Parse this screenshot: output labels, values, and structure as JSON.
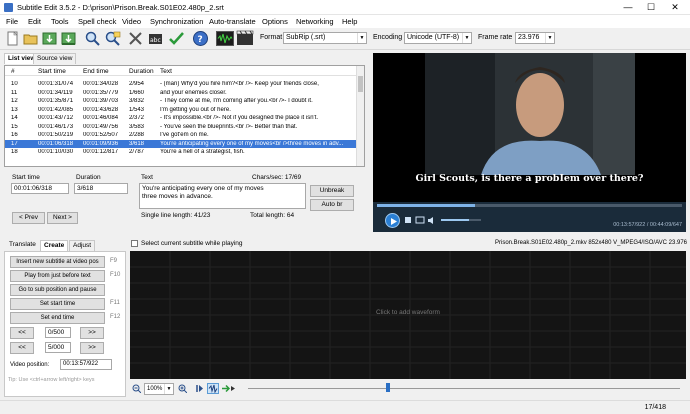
{
  "window": {
    "title": "Subtitle Edit 3.5.2 - D:\\prison\\Prison.Break.S01E02.480p_2.srt",
    "minimize": "—",
    "maximize": "☐",
    "close": "✕"
  },
  "menu": [
    "File",
    "Edit",
    "Tools",
    "Spell check",
    "Video",
    "Synchronization",
    "Auto-translate",
    "Options",
    "Networking",
    "Help"
  ],
  "toolbar": {
    "icons": [
      "new-file-icon",
      "open-folder-icon",
      "save-icon",
      "save-as-icon",
      "find-icon",
      "replace-icon",
      "fix-common-errors-icon",
      "burn-in-icon",
      "spell-check-icon",
      "help-icon",
      "waveform-toggle-icon",
      "video-toggle-icon"
    ],
    "format_label": "Format",
    "format_value": "SubRip (.srt)",
    "encoding_label": "Encoding",
    "encoding_value": "Unicode (UTF-8)",
    "framerate_label": "Frame rate",
    "framerate_value": "23.976"
  },
  "view_tabs": [
    "List view",
    "Source view"
  ],
  "list": {
    "columns": [
      "#",
      "Start time",
      "End time",
      "Duration",
      "Text"
    ],
    "rows": [
      {
        "n": "10",
        "start": "00:01:31/074",
        "end": "00:01:34/028",
        "dur": "2/954",
        "text": "- (man) Why'd you hire him?<br />- Keep your friends close,"
      },
      {
        "n": "11",
        "start": "00:01:34/119",
        "end": "00:01:35/779",
        "dur": "1/660",
        "text": "and your enemies closer."
      },
      {
        "n": "12",
        "start": "00:01:35/871",
        "end": "00:01:39/703",
        "dur": "3/832",
        "text": "- They come at me, I'm coming after you.<br />- I doubt it."
      },
      {
        "n": "13",
        "start": "00:01:42/085",
        "end": "00:01:43/628",
        "dur": "1/543",
        "text": "I'm getting you out of here."
      },
      {
        "n": "14",
        "start": "00:01:43/712",
        "end": "00:01:46/084",
        "dur": "2/372",
        "text": "- It's impossible.<br />- Not if you designed the place it isn't."
      },
      {
        "n": "15",
        "start": "00:01:46/173",
        "end": "00:01:49/756",
        "dur": "3/583",
        "text": "- You've seen the blueprints.<br />- Better than that."
      },
      {
        "n": "16",
        "start": "00:01:50/219",
        "end": "00:01:52/507",
        "dur": "2/288",
        "text": "I've got'em on me."
      },
      {
        "n": "17",
        "start": "00:01:06/318",
        "end": "00:01:09/936",
        "dur": "3/618",
        "text": "You're anticipating every one of my moves<br />three moves in adv..."
      },
      {
        "n": "18",
        "start": "00:01:10/030",
        "end": "00:01:12/817",
        "dur": "2/787",
        "text": "You're a hell of a strategist, fish."
      }
    ],
    "selected_index": 7
  },
  "editor": {
    "start_label": "Start time",
    "start_value": "00:01:06/318",
    "duration_label": "Duration",
    "duration_value": "3/618",
    "text_label": "Text",
    "chars_sec": "Chars/sec: 17/69",
    "text_line1": "You're anticipating every one of my moves",
    "text_line2": "three moves in advance.",
    "single_line_length": "Single line length: 41/23",
    "total_length": "Total length: 64",
    "unbreak": "Unbreak",
    "auto_br": "Auto br",
    "prev": "< Prev",
    "next": "Next >"
  },
  "video": {
    "subtitle": "Girl Scouts, is there a probIem over there?",
    "time": "00:13:57/922 / 00:44:09/647",
    "progress": 0.32,
    "volume": 0.7,
    "file_info": "Prison.Break.S01E02.480p_2.mkv 852x480 V_MPEG4/ISO/AVC 23.976"
  },
  "bottom_tabs": [
    "Translate",
    "Create",
    "Adjust"
  ],
  "create": {
    "insert": "Insert new subtitle at video pos",
    "insert_key": "F9",
    "play_before": "Play from just before text",
    "play_before_key": "F10",
    "goto": "Go to sub position and pause",
    "set_start": "Set start time",
    "set_start_key": "F11",
    "set_end": "Set end time",
    "set_end_key": "F12",
    "back1": "<<",
    "step1": "0/500",
    "fwd1": ">>",
    "back2": "<<",
    "step2": "5/000",
    "fwd2": ">>",
    "video_pos_label": "Video position:",
    "video_pos_value": "00:13:57/922",
    "tip": "Tip: Use <ctrl+arrow left/right> keys"
  },
  "waveform": {
    "select_current": "Select current subtitle while playing",
    "placeholder": "Click to add waveform",
    "zoom": "100%"
  },
  "status": {
    "position": "17/418"
  }
}
